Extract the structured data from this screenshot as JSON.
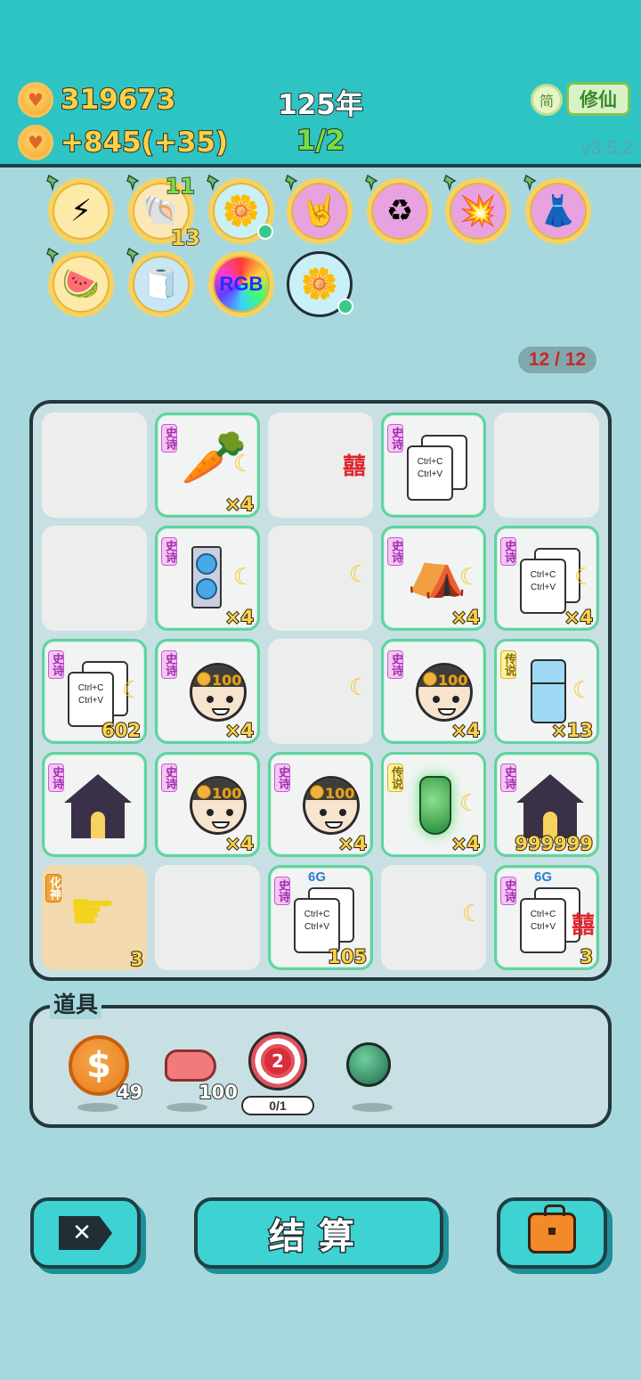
{
  "header": {
    "gold": "319673",
    "income": "+845(+35)",
    "year": "125年",
    "stage": "1/2",
    "lang_btn": "简",
    "mode_btn": "修仙",
    "version": "v3.5.2"
  },
  "relics": [
    {
      "name": "lightning",
      "glyph": "⚡"
    },
    {
      "name": "shell",
      "glyph": "🐚",
      "count_top": "11",
      "count_bottom": "13"
    },
    {
      "name": "flower-pot",
      "glyph": "🌼"
    },
    {
      "name": "rock-hand",
      "glyph": "🤘"
    },
    {
      "name": "recycle",
      "glyph": "♻"
    },
    {
      "name": "mushroom-cloud",
      "glyph": "💥"
    },
    {
      "name": "skirt",
      "glyph": "👗"
    },
    {
      "name": "fruit-bowl",
      "glyph": "🍉"
    },
    {
      "name": "tissue-box",
      "glyph": "🧻"
    },
    {
      "name": "rgb",
      "glyph": "RGB"
    },
    {
      "name": "flower-pot-plain",
      "glyph": "🌼"
    }
  ],
  "slot_counter": "12 / 12",
  "board": {
    "cells": [
      {
        "tag": "",
        "count": ""
      },
      {
        "tag": "史诗",
        "item": "carrot",
        "count": "×4"
      },
      {
        "tag": "",
        "item": "xi",
        "count": ""
      },
      {
        "tag": "史诗",
        "item": "ctrl-card",
        "count": ""
      },
      {
        "tag": "",
        "count": ""
      },
      {
        "tag": "",
        "count": ""
      },
      {
        "tag": "史诗",
        "item": "gpu",
        "count": "×4"
      },
      {
        "tag": "",
        "item": "moon",
        "count": ""
      },
      {
        "tag": "史诗",
        "item": "bunny-tent",
        "count": "×4"
      },
      {
        "tag": "史诗",
        "item": "ctrl-card",
        "count": "×4"
      },
      {
        "tag": "史诗",
        "item": "ctrl-card",
        "count": "602"
      },
      {
        "tag": "史诗",
        "item": "face",
        "count": "×4"
      },
      {
        "tag": "",
        "item": "moon",
        "count": ""
      },
      {
        "tag": "史诗",
        "item": "face",
        "count": "×4"
      },
      {
        "tag": "传说",
        "item": "fridge",
        "count": "×13"
      },
      {
        "tag": "史诗",
        "item": "house",
        "count": ""
      },
      {
        "tag": "史诗",
        "item": "face",
        "count": "×4"
      },
      {
        "tag": "史诗",
        "item": "face",
        "count": "×4"
      },
      {
        "tag": "传说",
        "item": "vase",
        "count": "×4"
      },
      {
        "tag": "史诗",
        "item": "house",
        "count": "999999"
      },
      {
        "tag": "化神",
        "item": "hand",
        "count": "3"
      },
      {
        "tag": "",
        "count": ""
      },
      {
        "tag": "史诗",
        "item": "ctrl-card-6g",
        "count": "105"
      },
      {
        "tag": "",
        "item": "moon",
        "count": ""
      },
      {
        "tag": "史诗",
        "item": "ctrl-card-6g",
        "count": "3"
      }
    ],
    "card_text_1": "Ctrl+C",
    "card_text_2": "Ctrl+V",
    "six_g": "6G",
    "face_badge": "100",
    "xi_glyph": "囍",
    "moon_glyph": "☾"
  },
  "items_panel": {
    "title": "道具",
    "coin_qty": "49",
    "coin_symbol": "$",
    "liver_qty": "100",
    "target_number": "2",
    "target_usage": "0/1"
  },
  "buttons": {
    "close_glyph": "✕",
    "settle": "结算"
  },
  "colors": {
    "background": "#a7d8dd",
    "header": "#2fc4c4",
    "gold_text": "#f9d24a",
    "stage_text": "#72e043",
    "epic_border": "#5ed49f"
  }
}
